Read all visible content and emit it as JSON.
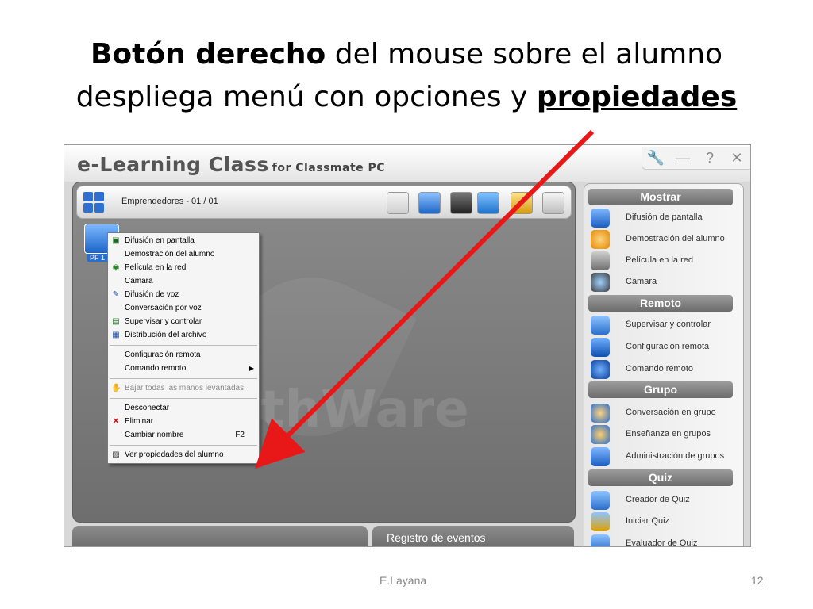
{
  "slide": {
    "title_bold1": "Botón derecho",
    "title_rest1": " del mouse  sobre el alumno",
    "title_rest2": "despliega menú con opciones y ",
    "title_bold2": "propiedades",
    "author": "E.Layana",
    "page": "12"
  },
  "app": {
    "brand": "e-Learning Class",
    "brand_sub": "for Classmate PC",
    "window_controls": [
      "🔧",
      "—",
      "?",
      "✕"
    ],
    "group_label": "Emprendedores - 01 / 01",
    "student_label": "PF 1",
    "watermark": "thWare",
    "events_label": "Registro de eventos"
  },
  "context_menu": {
    "items": [
      {
        "label": "Difusión en pantalla",
        "icon": "broadcast-icon"
      },
      {
        "label": "Demostración del alumno",
        "icon": ""
      },
      {
        "label": "Película en la red",
        "icon": "movie-icon"
      },
      {
        "label": "Cámara",
        "icon": ""
      },
      {
        "label": "Difusión de voz",
        "icon": "voice-icon"
      },
      {
        "label": "Conversación por voz",
        "icon": ""
      },
      {
        "label": "Supervisar y controlar",
        "icon": "monitor-icon"
      },
      {
        "label": "Distribución del archivo",
        "icon": "file-icon"
      },
      {
        "label": "Configuración remota",
        "icon": ""
      },
      {
        "label": "Comando remoto",
        "icon": ""
      },
      {
        "label": "Bajar todas las manos levantadas",
        "icon": "hand-icon"
      },
      {
        "label": "Desconectar",
        "icon": ""
      },
      {
        "label": "Eliminar",
        "icon": "delete-icon"
      },
      {
        "label": "Cambiar nombre",
        "icon": "",
        "shortcut": "F2"
      },
      {
        "label": "Ver propiedades del alumno",
        "icon": "properties-icon"
      }
    ]
  },
  "sidebar": {
    "sections": [
      {
        "title": "Mostrar",
        "items": [
          "Difusión de pantalla",
          "Demostración del alumno",
          "Película en la red",
          "Cámara"
        ]
      },
      {
        "title": "Remoto",
        "items": [
          "Supervisar y controlar",
          "Configuración remota",
          "Comando remoto"
        ]
      },
      {
        "title": "Grupo",
        "items": [
          "Conversación en grupo",
          "Enseñanza en grupos",
          "Administración de grupos"
        ]
      },
      {
        "title": "Quiz",
        "items": [
          "Creador de Quiz",
          "Iniciar Quiz",
          "Evaluador de Quiz"
        ]
      }
    ]
  },
  "colors": {
    "arrow": "#e81818",
    "accent_blue": "#2f6fcf",
    "section_header": "#7c7c7c"
  }
}
